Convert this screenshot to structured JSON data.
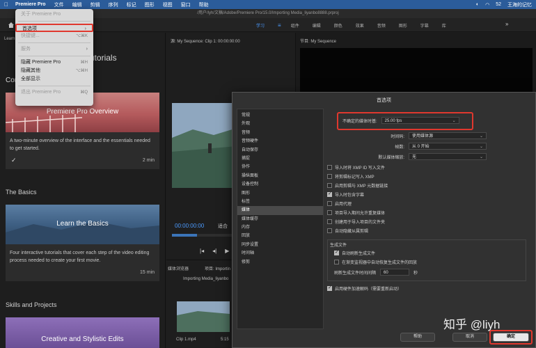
{
  "menubar": {
    "app": "Premiere Pro",
    "items": [
      "文件",
      "编辑",
      "剪辑",
      "序列",
      "标记",
      "图形",
      "视图",
      "窗口",
      "帮助"
    ],
    "right": [
      "52",
      "王海的记忆"
    ]
  },
  "titlebar": {
    "path": "/用户/lyh/文稿/Adobe/Premiere Pro/15.0/Importing Media_liyanbo8888.prproj"
  },
  "workspace": {
    "tabs": [
      "学习",
      "组件",
      "编辑",
      "颜色",
      "效果",
      "音频",
      "图形",
      "字幕",
      "库"
    ],
    "more": "»"
  },
  "program_menu": {
    "items": [
      {
        "label": "关于 Premiere Pro",
        "shortcut": "",
        "disabled": true
      },
      {
        "label": "首选项",
        "shortcut": "",
        "submenu": true,
        "highlight": true
      },
      {
        "label": "快捷键...",
        "shortcut": "⌥⌘K",
        "disabled": true
      },
      {
        "label": "服务",
        "shortcut": "",
        "submenu": true,
        "disabled": true
      },
      {
        "label": "隐藏 Premiere Pro",
        "shortcut": "⌘H"
      },
      {
        "label": "隐藏其他",
        "shortcut": "⌥⌘H"
      },
      {
        "label": "全部显示",
        "shortcut": ""
      },
      {
        "label": "退出 Premiere Pro",
        "shortcut": "⌘Q",
        "disabled": true
      }
    ]
  },
  "learn": {
    "tab": "Learn",
    "heading_partial": "Tutorials",
    "heading_left_partial": "Con",
    "cards": [
      {
        "title": "Premiere Pro Overview",
        "desc": "A two-minute overview of the interface and the essentials needed to get started.",
        "duration": "2 min",
        "check": "✓"
      },
      {
        "title": "Learn the Basics",
        "desc": "Four interactive tutorials that cover each step of the video editing process needed to create your first movie.",
        "duration": "15 min"
      },
      {
        "title": "Creative and Stylistic Edits"
      }
    ],
    "sections": [
      "The Basics",
      "Skills and Projects"
    ]
  },
  "source": {
    "tab": "源: My Sequence: Clip 1: 00:00:00:00",
    "timecode": "00:00:00:00",
    "fit": "适合"
  },
  "project": {
    "tab1": "媒体浏览器",
    "tab2": "项目: Importin",
    "file": "Importing Media_liyanbo",
    "clip": "Clip 1.mp4",
    "dur": "5:15"
  },
  "program": {
    "tab": "节目: My Sequence"
  },
  "dialog": {
    "title": "首选项",
    "categories": [
      "常规",
      "外观",
      "音频",
      "音频硬件",
      "自动保存",
      "捕捉",
      "协作",
      "操纵面板",
      "设备控制",
      "图形",
      "标签",
      "媒体",
      "媒体缓存",
      "内存",
      "回放",
      "同步设置",
      "时间轴",
      "修剪"
    ],
    "selected_category": "媒体",
    "fields": {
      "framerate_label": "不确定的媒体时基:",
      "framerate_value": "25.00 fps",
      "timecode_label": "时间码:",
      "timecode_value": "使用媒体源",
      "frame_label": "帧数:",
      "frame_value": "从 0 开始",
      "scale_label": "默认媒体缩放:",
      "scale_value": "无"
    },
    "checkboxes": [
      {
        "label": "导入时将 XMP ID 写入文件",
        "checked": false
      },
      {
        "label": "将剪辑标记写入 XMP",
        "checked": false
      },
      {
        "label": "启用剪辑与 XMP 元数据链接",
        "checked": false
      },
      {
        "label": "导入时包含字幕",
        "checked": true
      },
      {
        "label": "启用代理",
        "checked": false
      },
      {
        "label": "项目导入期间允许重复媒体",
        "checked": false
      },
      {
        "label": "创建用于导入项目的文件夹",
        "checked": false
      },
      {
        "label": "自动隐藏从属剪辑",
        "checked": false
      }
    ],
    "growing": {
      "title": "生成文件",
      "auto_refresh": "自动刷新生成文件",
      "auto_refresh_checked": true,
      "monitor": "在渐变监视器中自动恢复生成文件的回放",
      "monitor_checked": false,
      "interval_label": "刷新生成文件时间间隔",
      "interval_value": "60",
      "interval_unit": "秒"
    },
    "hw_decode": "启用硬件加速解码（需要重新启动）",
    "hw_decode_checked": true,
    "buttons": {
      "help": "帮助",
      "cancel": "取消",
      "ok": "确定"
    }
  },
  "watermark": "知乎 @liyh"
}
